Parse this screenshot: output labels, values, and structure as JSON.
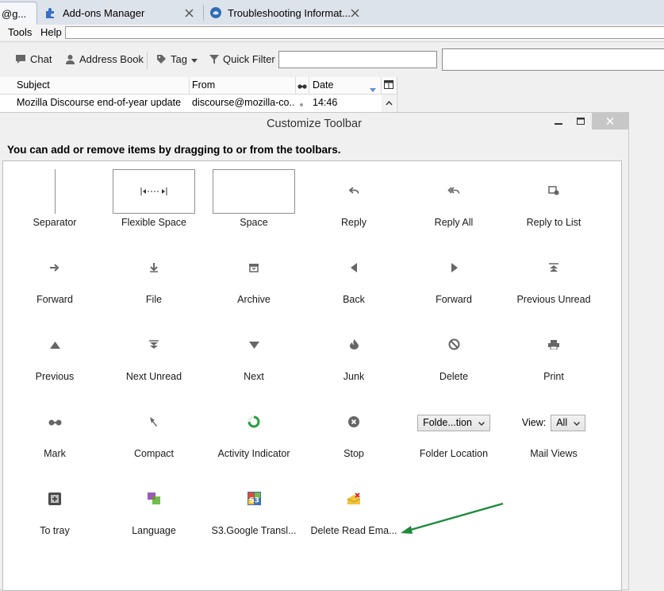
{
  "tabs": [
    {
      "label": "@g..."
    },
    {
      "label": "Add-ons Manager"
    },
    {
      "label": "Troubleshooting Informat..."
    }
  ],
  "menubar": {
    "tools": "Tools",
    "help": "Help"
  },
  "toolbar": {
    "chat": "Chat",
    "address_book": "Address Book",
    "tag": "Tag",
    "quick_filter": "Quick Filter"
  },
  "threads": {
    "columns": {
      "subject": "Subject",
      "from": "From",
      "date": "Date"
    },
    "rows": [
      {
        "subject": "Mozilla Discourse end-of-year update",
        "from": "discourse@mozilla-co...",
        "date": "14:46"
      }
    ]
  },
  "dialog": {
    "title": "Customize Toolbar",
    "close": "✕",
    "instructions": "You can add or remove items by dragging to or from the toolbars.",
    "items": [
      {
        "label": "Separator",
        "icon": "separator-icon"
      },
      {
        "label": "Flexible Space",
        "icon": "flexible-space-icon"
      },
      {
        "label": "Space",
        "icon": "space-icon"
      },
      {
        "label": "Reply",
        "icon": "reply-icon"
      },
      {
        "label": "Reply All",
        "icon": "reply-all-icon"
      },
      {
        "label": "Reply to List",
        "icon": "reply-list-icon"
      },
      {
        "label": "Forward",
        "icon": "forward-icon"
      },
      {
        "label": "File",
        "icon": "file-icon"
      },
      {
        "label": "Archive",
        "icon": "archive-icon"
      },
      {
        "label": "Back",
        "icon": "back-icon"
      },
      {
        "label": "Forward",
        "icon": "forward-nav-icon"
      },
      {
        "label": "Previous Unread",
        "icon": "previous-unread-icon"
      },
      {
        "label": "Previous",
        "icon": "previous-icon"
      },
      {
        "label": "Next Unread",
        "icon": "next-unread-icon"
      },
      {
        "label": "Next",
        "icon": "next-icon"
      },
      {
        "label": "Junk",
        "icon": "junk-icon"
      },
      {
        "label": "Delete",
        "icon": "delete-icon"
      },
      {
        "label": "Print",
        "icon": "print-icon"
      },
      {
        "label": "Mark",
        "icon": "mark-icon"
      },
      {
        "label": "Compact",
        "icon": "compact-icon"
      },
      {
        "label": "Activity Indicator",
        "icon": "activity-indicator-icon"
      },
      {
        "label": "Stop",
        "icon": "stop-icon"
      },
      {
        "label": "Folder Location",
        "icon": "folder-location-dropdown"
      },
      {
        "label": "Mail Views",
        "icon": "mail-views-dropdown"
      },
      {
        "label": "To tray",
        "icon": "to-tray-icon"
      },
      {
        "label": "Language",
        "icon": "language-icon"
      },
      {
        "label": "S3.Google Transl...",
        "icon": "s3-google-translate-icon"
      },
      {
        "label": "Delete Read Ema...",
        "icon": "delete-read-email-icon"
      }
    ],
    "folder_location_value": "Folde...tion",
    "mail_views_label": "View:",
    "mail_views_value": "All"
  },
  "colors": {
    "annotation_arrow": "#1e8a3c"
  }
}
